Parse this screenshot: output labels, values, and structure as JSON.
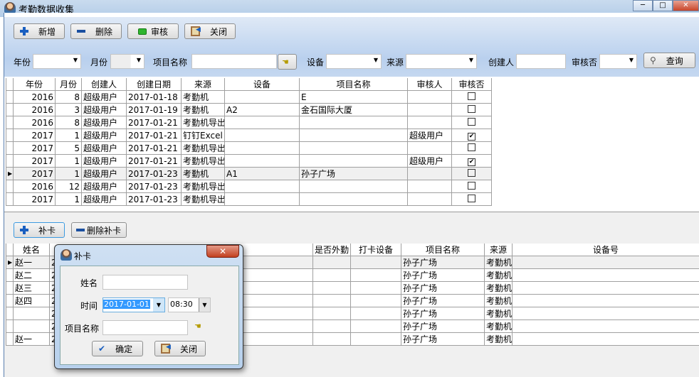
{
  "window": {
    "title": "考勤数据收集",
    "minimize": "─",
    "maximize": "□",
    "close": "✕"
  },
  "toolbar": {
    "add": "新增",
    "delete": "删除",
    "audit": "审核",
    "close": "关闭"
  },
  "filters": {
    "year_label": "年份",
    "year_value": "",
    "month_label": "月份",
    "month_value": "",
    "project_label": "项目名称",
    "project_value": "",
    "device_label": "设备",
    "device_value": "",
    "source_label": "来源",
    "source_value": "",
    "creator_label": "创建人",
    "creator_value": "",
    "audited_label": "审核否",
    "audited_value": "",
    "query": "查询"
  },
  "main_grid": {
    "columns": [
      "年份",
      "月份",
      "创建人",
      "创建日期",
      "来源",
      "设备",
      "项目名称",
      "审核人",
      "审核否"
    ],
    "current_row": 6,
    "rows": [
      [
        "2016",
        "8",
        "超级用户",
        "2017-01-18",
        "考勤机",
        "",
        "E",
        "",
        false
      ],
      [
        "2016",
        "3",
        "超级用户",
        "2017-01-19",
        "考勤机",
        "A2",
        "金石国际大厦",
        "",
        false
      ],
      [
        "2016",
        "8",
        "超级用户",
        "2017-01-21",
        "考勤机导出",
        "",
        "",
        "",
        false
      ],
      [
        "2017",
        "1",
        "超级用户",
        "2017-01-21",
        "钉钉Excel",
        "",
        "",
        "超级用户",
        true
      ],
      [
        "2017",
        "5",
        "超级用户",
        "2017-01-21",
        "考勤机导出",
        "",
        "",
        "",
        false
      ],
      [
        "2017",
        "1",
        "超级用户",
        "2017-01-21",
        "考勤机导出",
        "",
        "",
        "超级用户",
        true
      ],
      [
        "2017",
        "1",
        "超级用户",
        "2017-01-23",
        "考勤机",
        "A1",
        "孙子广场",
        "",
        false
      ],
      [
        "2016",
        "12",
        "超级用户",
        "2017-01-23",
        "考勤机导出",
        "",
        "",
        "",
        false
      ],
      [
        "2017",
        "1",
        "超级用户",
        "2017-01-23",
        "考勤机导出",
        "",
        "",
        "",
        false
      ]
    ]
  },
  "detail_toolbar": {
    "add_punch": "补卡",
    "delete_punch": "删除补卡"
  },
  "detail_grid": {
    "columns": [
      "姓名",
      "",
      "是否外勤",
      "打卡设备",
      "项目名称",
      "来源",
      "设备号"
    ],
    "current_row": 0,
    "rows": [
      [
        "赵一",
        "2",
        "",
        "",
        "孙子广场",
        "考勤机",
        ""
      ],
      [
        "赵二",
        "2",
        "",
        "",
        "孙子广场",
        "考勤机",
        ""
      ],
      [
        "赵三",
        "2",
        "",
        "",
        "孙子广场",
        "考勤机",
        ""
      ],
      [
        "赵四",
        "2",
        "",
        "",
        "孙子广场",
        "考勤机",
        ""
      ],
      [
        "",
        "2",
        "",
        "",
        "孙子广场",
        "考勤机",
        ""
      ],
      [
        "",
        "2",
        "",
        "",
        "孙子广场",
        "考勤机",
        ""
      ],
      [
        "赵一",
        "2",
        "",
        "",
        "孙子广场",
        "考勤机",
        ""
      ]
    ]
  },
  "dialog": {
    "title": "补卡",
    "close": "✕",
    "name_label": "姓名",
    "name_value": "",
    "time_label": "时间",
    "date_value": "2017-01-01",
    "time_value": "08:30",
    "project_label": "项目名称",
    "project_value": "",
    "ok": "确定",
    "cancel": "关闭"
  },
  "colors": {
    "title_bg": "#b4cde8",
    "toolbar_bg": "#b9d0ee",
    "selection": "#3399ff",
    "dialog_close": "#c2401f"
  }
}
